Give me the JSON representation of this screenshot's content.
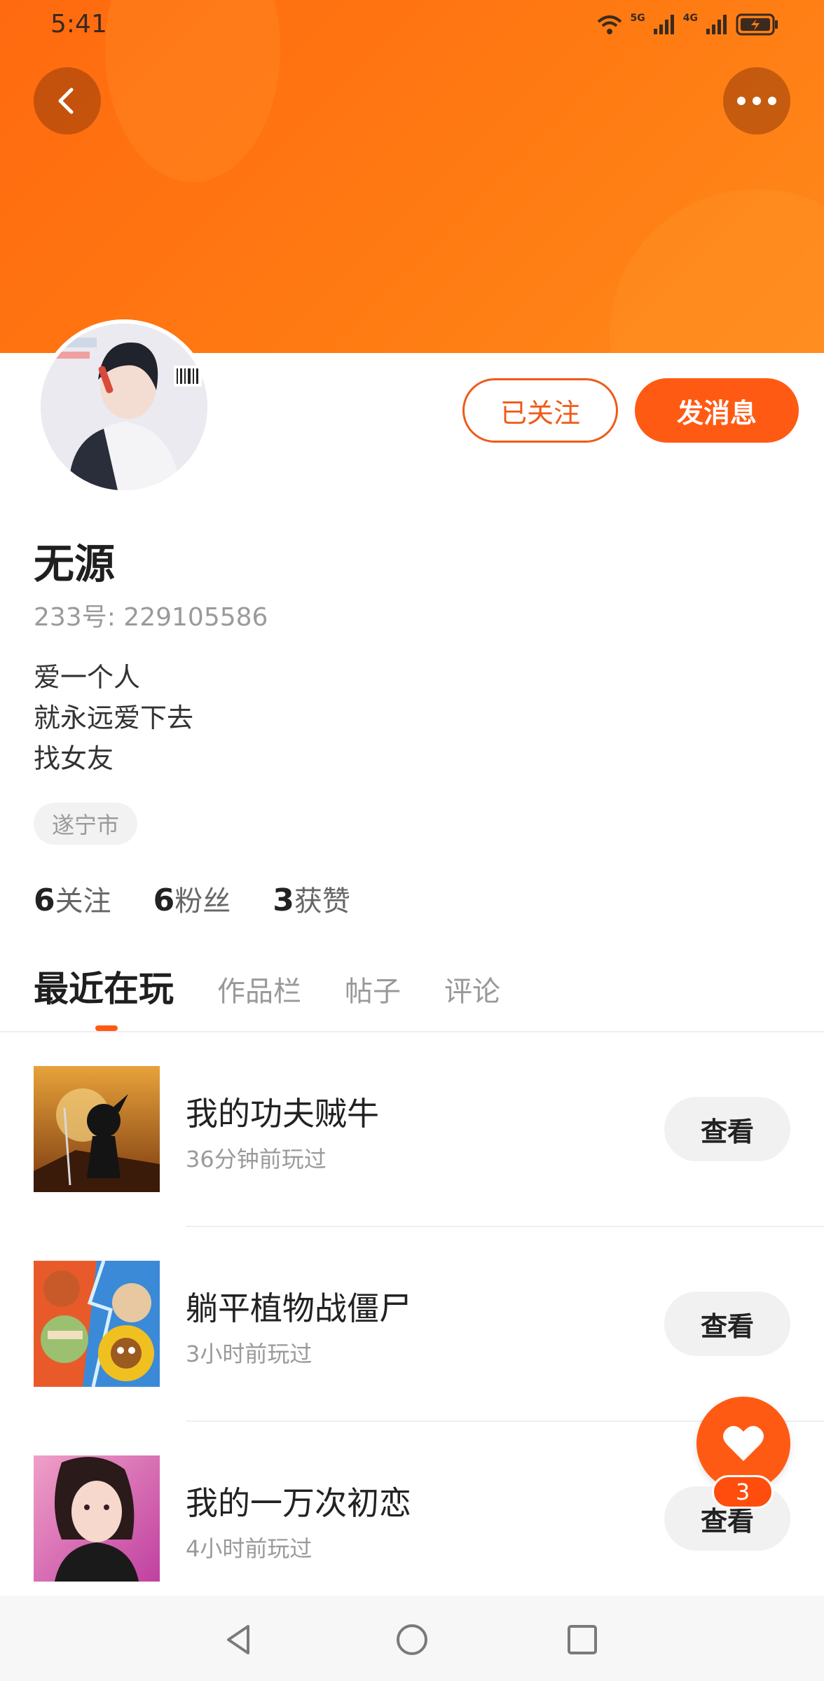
{
  "status_bar": {
    "time": "5:41",
    "signal1": "5G",
    "signal2": "4G"
  },
  "header": {
    "back_icon": "chevron-left-icon",
    "more_icon": "more-horizontal-icon"
  },
  "profile": {
    "follow_label": "已关注",
    "message_label": "发消息",
    "name": "无源",
    "id_label": "233号:",
    "id_value": "229105586",
    "bio_lines": [
      "爱一个人",
      "就永远爱下去",
      "找女友"
    ],
    "location": "遂宁市",
    "stats": [
      {
        "count": "6",
        "label": "关注"
      },
      {
        "count": "6",
        "label": "粉丝"
      },
      {
        "count": "3",
        "label": "获赞"
      }
    ]
  },
  "tabs": [
    {
      "label": "最近在玩",
      "active": true
    },
    {
      "label": "作品栏",
      "active": false
    },
    {
      "label": "帖子",
      "active": false
    },
    {
      "label": "评论",
      "active": false
    }
  ],
  "games": [
    {
      "name": "我的功夫贼牛",
      "time": "36分钟前玩过",
      "action": "查看"
    },
    {
      "name": "躺平植物战僵尸",
      "time": "3小时前玩过",
      "action": "查看"
    },
    {
      "name": "我的一万次初恋",
      "time": "4小时前玩过",
      "action": "查看"
    }
  ],
  "fab": {
    "icon": "heart-icon",
    "badge": "3"
  },
  "colors": {
    "accent": "#ff5a14",
    "banner": "#ff7a12"
  }
}
